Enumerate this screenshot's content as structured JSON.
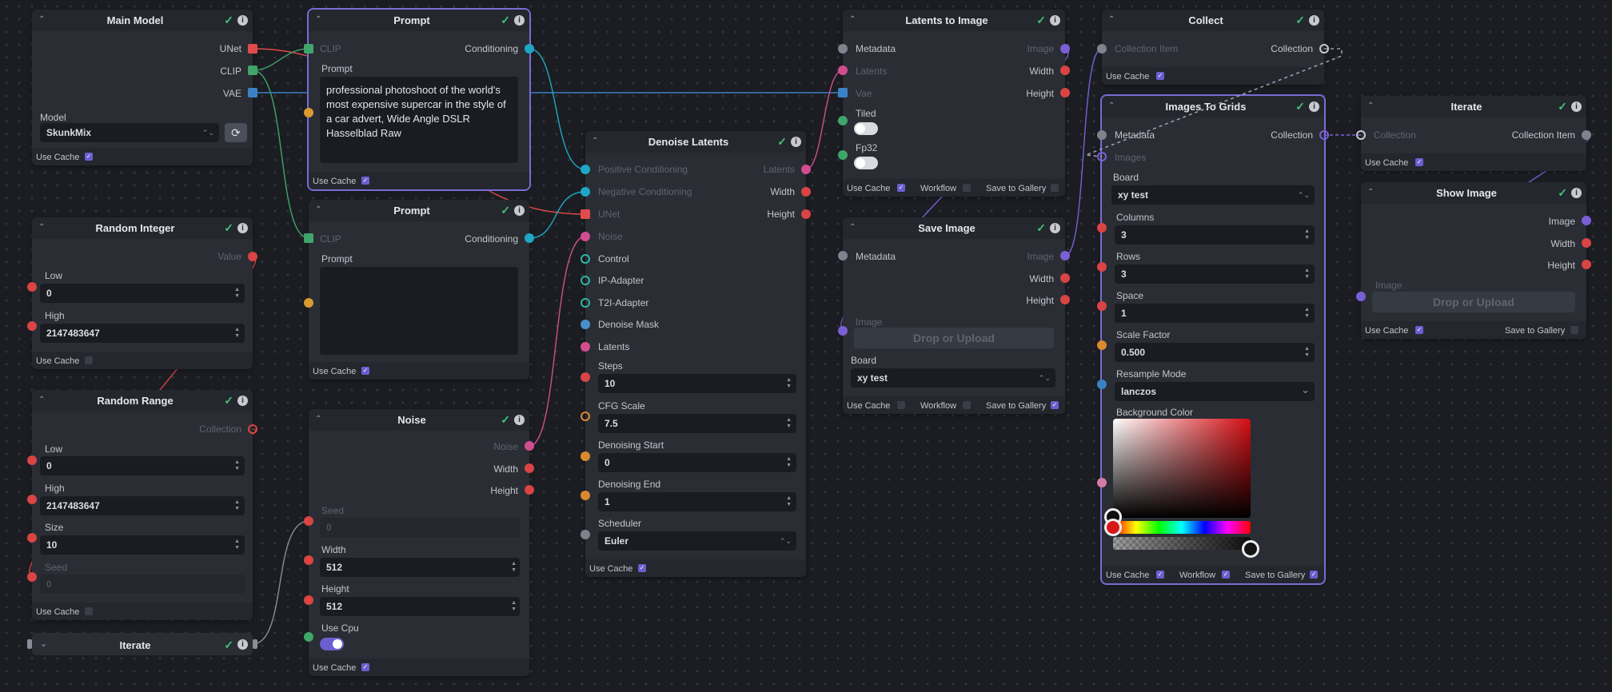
{
  "colors": {
    "unet": "#e04b4b",
    "clip": "#3fa56a",
    "vae": "#3b82c4",
    "conditioning": "#1ea7c4",
    "latents": "#d24d90",
    "integer": "#d94444",
    "float": "#d98a2e",
    "image": "#7a5fd6",
    "metadata": "#7f838e",
    "board": "#7f838e",
    "selected": "#7b6bd6"
  },
  "check_mark": "✓",
  "info_mark": "i",
  "collapse_icon": "⌃",
  "expand_icon": "⌄",
  "spin_up": "▲",
  "spin_down": "▼",
  "select_arrows": "⌃⌄",
  "chevron": "⌄",
  "refresh_icon": "⟳",
  "main_model": {
    "title": "Main Model",
    "out_unet": "UNet",
    "out_clip": "CLIP",
    "out_vae": "VAE",
    "model_label": "Model",
    "model_value": "SkunkMix",
    "use_cache": "Use Cache"
  },
  "prompt1": {
    "title": "Prompt",
    "in_clip": "CLIP",
    "out_conditioning": "Conditioning",
    "prompt_label": "Prompt",
    "prompt_value": "professional photoshoot of the world's most expensive supercar in the style of a car advert, Wide Angle DSLR Hasselblad Raw",
    "use_cache": "Use Cache"
  },
  "prompt2": {
    "title": "Prompt",
    "in_clip": "CLIP",
    "out_conditioning": "Conditioning",
    "prompt_label": "Prompt",
    "prompt_value": "",
    "use_cache": "Use Cache"
  },
  "random_integer": {
    "title": "Random Integer",
    "out_value": "Value",
    "low_label": "Low",
    "low_value": "0",
    "high_label": "High",
    "high_value": "2147483647",
    "use_cache": "Use Cache"
  },
  "random_range": {
    "title": "Random Range",
    "out_collection": "Collection",
    "low_label": "Low",
    "low_value": "0",
    "high_label": "High",
    "high_value": "2147483647",
    "size_label": "Size",
    "size_value": "10",
    "seed_label": "Seed",
    "seed_value": "0",
    "use_cache": "Use Cache"
  },
  "iterate_left": {
    "title": "Iterate"
  },
  "noise": {
    "title": "Noise",
    "out_noise": "Noise",
    "out_width": "Width",
    "out_height": "Height",
    "seed_label": "Seed",
    "seed_value": "0",
    "width_label": "Width",
    "width_value": "512",
    "height_label": "Height",
    "height_value": "512",
    "use_cpu_label": "Use Cpu",
    "use_cache": "Use Cache"
  },
  "denoise": {
    "title": "Denoise Latents",
    "in_pos": "Positive Conditioning",
    "in_neg": "Negative Conditioning",
    "in_unet": "UNet",
    "in_noise": "Noise",
    "in_control": "Control",
    "in_ip": "IP-Adapter",
    "in_t2i": "T2I-Adapter",
    "in_mask": "Denoise Mask",
    "in_latents": "Latents",
    "out_latents": "Latents",
    "out_width": "Width",
    "out_height": "Height",
    "steps_label": "Steps",
    "steps_value": "10",
    "cfg_label": "CFG Scale",
    "cfg_value": "7.5",
    "dstart_label": "Denoising Start",
    "dstart_value": "0",
    "dend_label": "Denoising End",
    "dend_value": "1",
    "sched_label": "Scheduler",
    "sched_value": "Euler",
    "use_cache": "Use Cache"
  },
  "l2i": {
    "title": "Latents to Image",
    "in_metadata": "Metadata",
    "in_latents": "Latents",
    "in_vae": "Vae",
    "tiled_label": "Tiled",
    "fp32_label": "Fp32",
    "out_image": "Image",
    "out_width": "Width",
    "out_height": "Height",
    "use_cache": "Use Cache",
    "workflow": "Workflow",
    "save_gallery": "Save to Gallery"
  },
  "save_image": {
    "title": "Save Image",
    "in_metadata": "Metadata",
    "in_image": "Image",
    "drop": "Drop or Upload",
    "board_label": "Board",
    "board_value": "xy test",
    "out_image": "Image",
    "out_width": "Width",
    "out_height": "Height",
    "use_cache": "Use Cache",
    "workflow": "Workflow",
    "save_gallery": "Save to Gallery"
  },
  "collect": {
    "title": "Collect",
    "in_item": "Collection Item",
    "out_collection": "Collection",
    "use_cache": "Use Cache"
  },
  "grids": {
    "title": "Images To Grids",
    "in_metadata": "Metadata",
    "in_images": "Images",
    "out_collection": "Collection",
    "board_label": "Board",
    "board_value": "xy test",
    "columns_label": "Columns",
    "columns_value": "3",
    "rows_label": "Rows",
    "rows_value": "3",
    "space_label": "Space",
    "space_value": "1",
    "scale_label": "Scale Factor",
    "scale_value": "0.500",
    "resample_label": "Resample Mode",
    "resample_value": "lanczos",
    "bg_label": "Background Color",
    "use_cache": "Use Cache",
    "workflow": "Workflow",
    "save_gallery": "Save to Gallery"
  },
  "iterate_right": {
    "title": "Iterate",
    "in_collection": "Collection",
    "out_item": "Collection Item",
    "use_cache": "Use Cache"
  },
  "show_image": {
    "title": "Show Image",
    "out_image": "Image",
    "out_width": "Width",
    "out_height": "Height",
    "in_image": "Image",
    "drop": "Drop or Upload",
    "use_cache": "Use Cache",
    "save_gallery": "Save to Gallery"
  }
}
